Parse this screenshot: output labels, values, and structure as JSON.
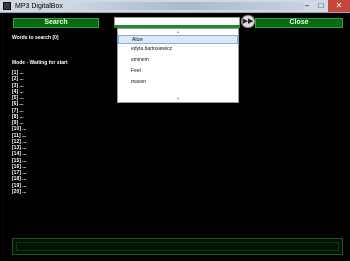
{
  "window": {
    "title": "MP3 DigitalBox",
    "minimize_glyph": "–",
    "maximize_glyph": "□",
    "close_glyph": "✕"
  },
  "toolbar": {
    "search_label": "Search",
    "close_label": "Close",
    "search_value": "",
    "go_glyph": "▶▶"
  },
  "dropdown": {
    "up_glyph": "▲",
    "down_glyph": "▼",
    "items": [
      "Alize",
      "edyta bartosiewicz",
      "eminem",
      "Feel",
      "mason"
    ],
    "selected_index": 0
  },
  "status": {
    "words_to_search": "Words to search [0]",
    "mode": "Mode - Waiting for start"
  },
  "slots": [
    "[1] ...",
    "[2] ...",
    "[3] ...",
    "[4] ...",
    "[5] ...",
    "[6] ...",
    "[7] ...",
    "[8] ...",
    "[9] ...",
    "[10] ...",
    "[11] ...",
    "[12] ...",
    "[13] ...",
    "[14] ...",
    "[15] ...",
    "[16] ...",
    "[17] ...",
    "[18] ...",
    "[19] ...",
    "[20] ..."
  ],
  "colors": {
    "accent_green": "#0a6a14",
    "background": "#000000"
  }
}
